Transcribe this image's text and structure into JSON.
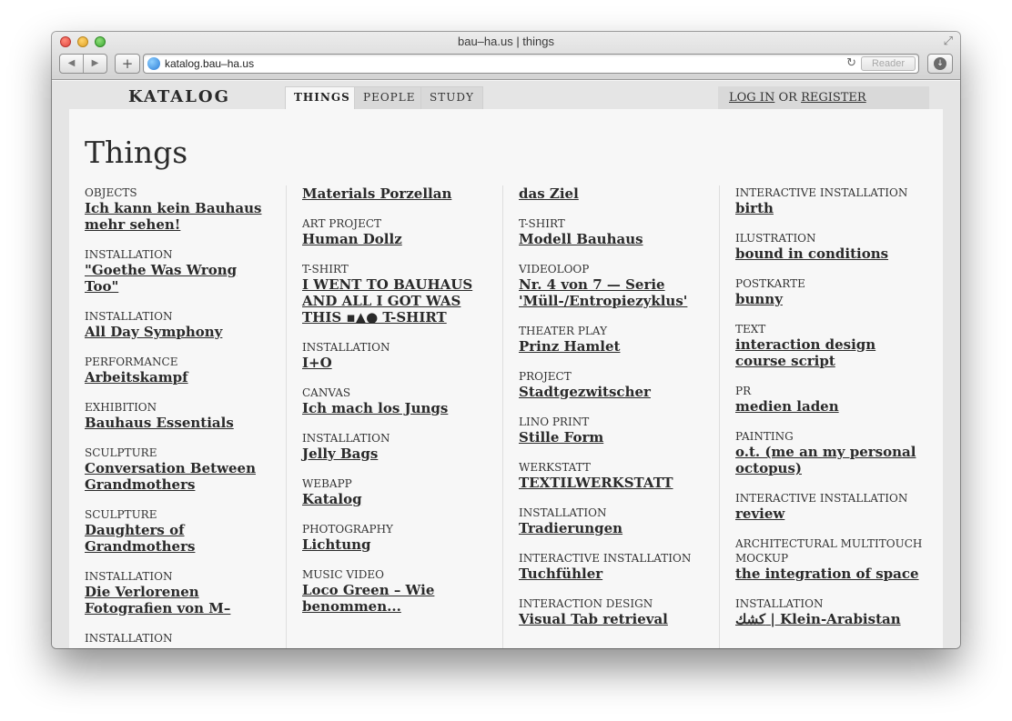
{
  "browser": {
    "title": "bau–ha.us | things",
    "url": "katalog.bau–ha.us",
    "reader_label": "Reader",
    "back_icon": "◀",
    "forward_icon": "▶",
    "add_icon": "+",
    "reload_icon": "↻",
    "download_icon": "↓",
    "fullscreen_icon": "⤢"
  },
  "nav": {
    "brand": "KATALOG",
    "tabs": [
      {
        "label": "THINGS",
        "active": true
      },
      {
        "label": "PEOPLE",
        "active": false
      },
      {
        "label": "STUDY",
        "active": false
      }
    ],
    "login": "LOG IN",
    "or": "OR",
    "register": "REGISTER"
  },
  "page": {
    "title": "Things"
  },
  "columns": [
    {
      "items": [
        {
          "category": "OBJECTS",
          "title": "Ich kann kein Bauhaus mehr sehen!"
        },
        {
          "category": "INSTALLATION",
          "title": "\"Goethe Was Wrong Too\""
        },
        {
          "category": "INSTALLATION",
          "title": "All Day Symphony"
        },
        {
          "category": "PERFORMANCE",
          "title": "Arbeitskampf"
        },
        {
          "category": "EXHIBITION",
          "title": "Bauhaus Essentials"
        },
        {
          "category": "SCULPTURE",
          "title": "Conversation Between Grandmothers"
        },
        {
          "category": "SCULPTURE",
          "title": "Daughters of Grandmothers"
        },
        {
          "category": "INSTALLATION",
          "title": "Die Verlorenen Fotografien von M–"
        },
        {
          "category": "INSTALLATION",
          "title": ""
        }
      ]
    },
    {
      "items": [
        {
          "category": "",
          "title": "Materials Porzellan"
        },
        {
          "category": "ART PROJECT",
          "title": "Human Dollz"
        },
        {
          "category": "T-SHIRT",
          "title": "I WENT TO BAUHAUS AND ALL I GOT WAS THIS ▪▲● T-SHIRT"
        },
        {
          "category": "INSTALLATION",
          "title": "I+O"
        },
        {
          "category": "CANVAS",
          "title": "Ich mach los Jungs"
        },
        {
          "category": "INSTALLATION",
          "title": "Jelly Bags"
        },
        {
          "category": "WEBAPP",
          "title": "Katalog"
        },
        {
          "category": "PHOTOGRAPHY",
          "title": "Lichtung"
        },
        {
          "category": "MUSIC VIDEO",
          "title": "Loco Green – Wie benommen..."
        }
      ]
    },
    {
      "items": [
        {
          "category": "",
          "title": "das Ziel"
        },
        {
          "category": "T-SHIRT",
          "title": "Modell Bauhaus"
        },
        {
          "category": "VIDEOLOOP",
          "title": "Nr. 4 von 7 — Serie 'Müll-/Entropiezyklus'"
        },
        {
          "category": "THEATER PLAY",
          "title": "Prinz Hamlet"
        },
        {
          "category": "PROJECT",
          "title": "Stadtgezwitscher"
        },
        {
          "category": "LINO PRINT",
          "title": "Stille Form"
        },
        {
          "category": "WERKSTATT",
          "title": "TEXTILWERKSTATT"
        },
        {
          "category": "INSTALLATION",
          "title": "Tradierungen"
        },
        {
          "category": "INTERACTIVE INSTALLATION",
          "title": "Tuchfühler"
        },
        {
          "category": "INTERACTION DESIGN",
          "title": "Visual Tab retrieval"
        }
      ]
    },
    {
      "items": [
        {
          "category": "INTERACTIVE INSTALLATION",
          "title": "birth"
        },
        {
          "category": "ILUSTRATION",
          "title": "bound in conditions"
        },
        {
          "category": "POSTKARTE",
          "title": "bunny"
        },
        {
          "category": "TEXT",
          "title": "interaction design course script"
        },
        {
          "category": "PR",
          "title": "medien laden"
        },
        {
          "category": "PAINTING",
          "title": "o.t. (me an my personal octopus)"
        },
        {
          "category": "INTERACTIVE INSTALLATION",
          "title": "review"
        },
        {
          "category": "ARCHITECTURAL MULTITOUCH MOCKUP",
          "title": "the integration of space"
        },
        {
          "category": "INSTALLATION",
          "title": "كشك | Klein-Arabistan"
        }
      ]
    }
  ]
}
